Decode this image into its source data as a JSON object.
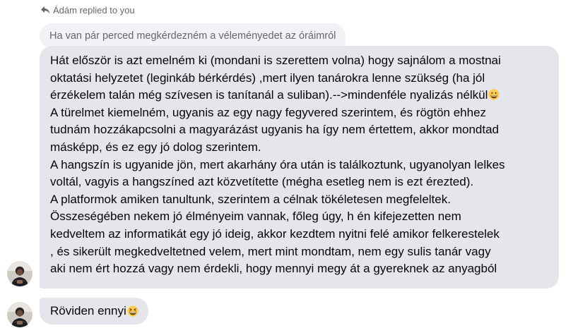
{
  "reply": {
    "header_text": "Ádám replied to you",
    "header_icon": "reply-arrow-icon",
    "quoted_text": "Ha van pár perced megkérdezném a véleményedet az óráimról"
  },
  "message": {
    "lines": [
      "Hát először is azt emelném ki (mondani is szerettem volna) hogy sajnálom a mostnai",
      "oktatási helyzetet (leginkáb bérkérdés) ,mert ilyen tanárokra lenne szükség (ha jól",
      "érzékelem talán még szívesen is tanítanál a suliban).-->mindenféle nyalizás nélkül",
      "A türelmet kiemelném, ugyanis az egy nagy fegyvered szerintem, és rögtön ehhez",
      "tudnám hozzákapcsolni a magyarázást ugyanis ha így nem értettem, akkor mondtad",
      "másképp, és ez egy jó dolog szerintem.",
      "A hangszín is ugyanide jön, mert akarhány óra után is találkoztunk, ugyanolyan lelkes",
      "voltál, vagyis a hangszíned azt közvetítette (mégha esetleg nem is ezt érezted).",
      "A platformok amiken tanultunk, szerintem a célnak tökéletesen megfeleltek.",
      "Összeségében nekem jó élményeim vannak, főleg úgy, h én kifejezetten nem",
      "kedveltem az informatikát egy jó ideig, akkor kezdtem nyitni felé amikor felkerestelek",
      ", és sikerült megkedveltetned velem, mert mint mondtam, nem egy sulis tanár vagy",
      "aki nem ért hozzá vagy nem érdekli, hogy mennyi megy át a gyereknek az anyagból"
    ],
    "inline_emoji": "grinning-face-emoji"
  },
  "short_message": {
    "text": "Röviden ennyi",
    "emoji": "grinning-squinting-face-emoji"
  },
  "colors": {
    "bubble_bg": "#e4e6eb",
    "quoted_bg": "#f0f2f5",
    "secondary_text": "#65676b",
    "primary_text": "#050505",
    "emoji_yellow": "#ffcc4d"
  }
}
